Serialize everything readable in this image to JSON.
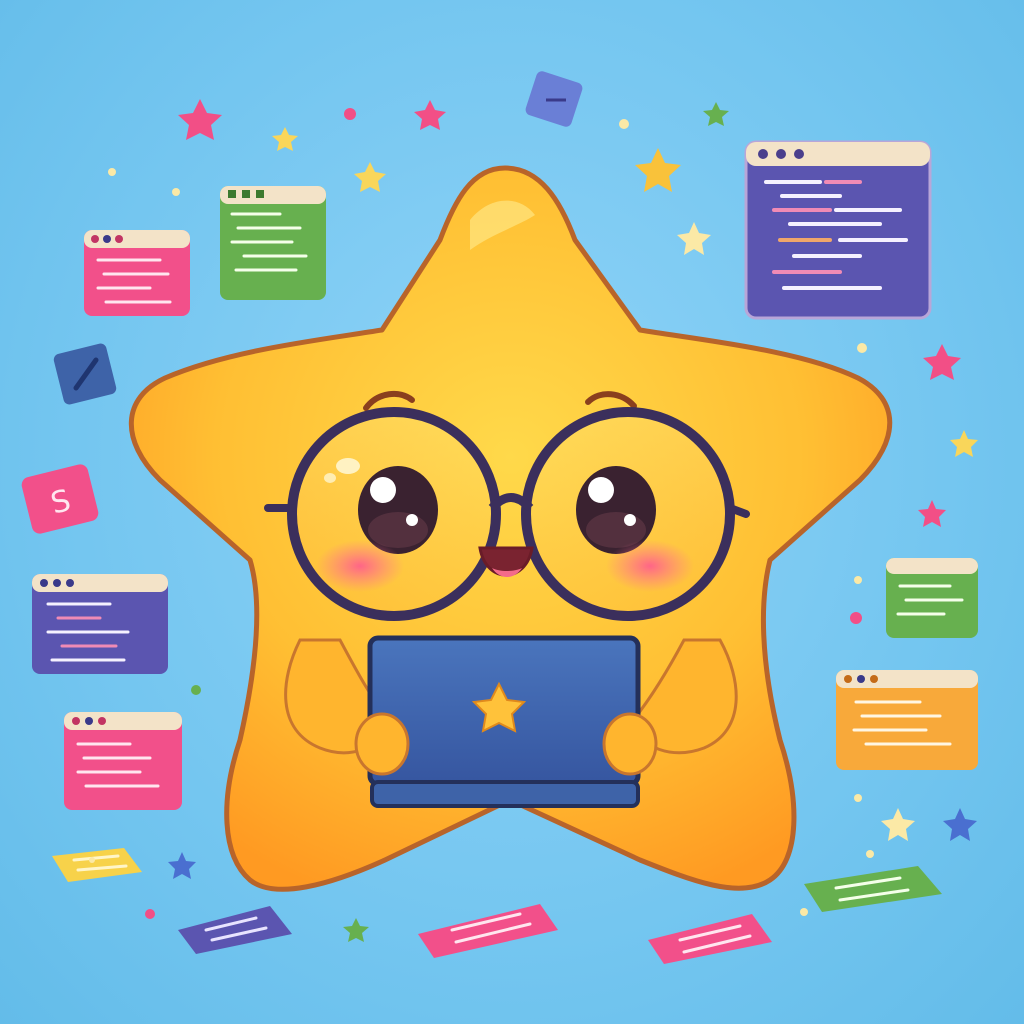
{
  "scene": {
    "subject": "cartoon-star-with-glasses-and-laptop",
    "palette": {
      "background": "#74c6f0",
      "star_body": "#ffb52e",
      "star_outline": "#b8642a",
      "glasses": "#3b2f5c",
      "laptop": "#3e63a8",
      "window_purple": "#5b55b0",
      "window_green": "#67b04f",
      "window_pink": "#f2508a",
      "window_orange": "#f8a93a",
      "window_titlebar": "#f3e3c8",
      "confetti_pink": "#f24f86",
      "confetti_yellow": "#f9d65a"
    },
    "icons": [
      "code-window-icon",
      "star-icon",
      "dollar-sign-icon",
      "pencil-icon",
      "laptop-icon"
    ],
    "sign_glyph": "S"
  }
}
